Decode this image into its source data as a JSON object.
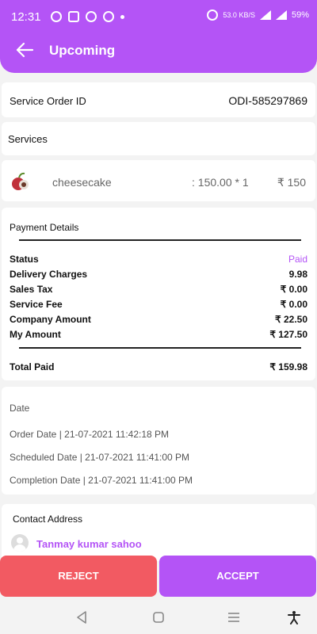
{
  "status_bar": {
    "time": "12:31",
    "net_speed": "53.0",
    "net_unit": "KB/S",
    "battery": "59%"
  },
  "header": {
    "title": "Upcoming",
    "back_icon": "arrow-left-icon"
  },
  "order": {
    "label": "Service Order ID",
    "value": "ODI-585297869"
  },
  "services": {
    "title": "Services",
    "items": [
      {
        "name": "cheesecake",
        "qty": ": 150.00 * 1",
        "price": "₹ 150",
        "icon": "lychee-icon"
      }
    ]
  },
  "payment": {
    "title": "Payment Details",
    "rows": [
      {
        "label": "Status",
        "value": "Paid"
      },
      {
        "label": "Delivery Charges",
        "value": "9.98"
      },
      {
        "label": "Sales Tax",
        "value": "₹  0.00"
      },
      {
        "label": "Service Fee",
        "value": "₹  0.00"
      },
      {
        "label": "Company Amount",
        "value": "₹  22.50"
      },
      {
        "label": "My Amount",
        "value": "₹  127.50"
      }
    ],
    "total_label": "Total Paid",
    "total_value": "₹  159.98",
    "status_color": "#b454f6"
  },
  "dates": {
    "title": "Date",
    "order_date": "Order Date | 21-07-2021 11:42:18 PM",
    "scheduled_date": "Scheduled Date | 21-07-2021 11:41:00 PM",
    "completion_date": "Completion Date | 21-07-2021 11:41:00 PM"
  },
  "contact": {
    "title": "Contact Address",
    "name": "Tanmay kumar sahoo"
  },
  "actions": {
    "reject": "REJECT",
    "accept": "ACCEPT",
    "reject_color": "#f25a62",
    "accept_color": "#b454f6"
  },
  "theme": {
    "accent": "#b454f6"
  }
}
